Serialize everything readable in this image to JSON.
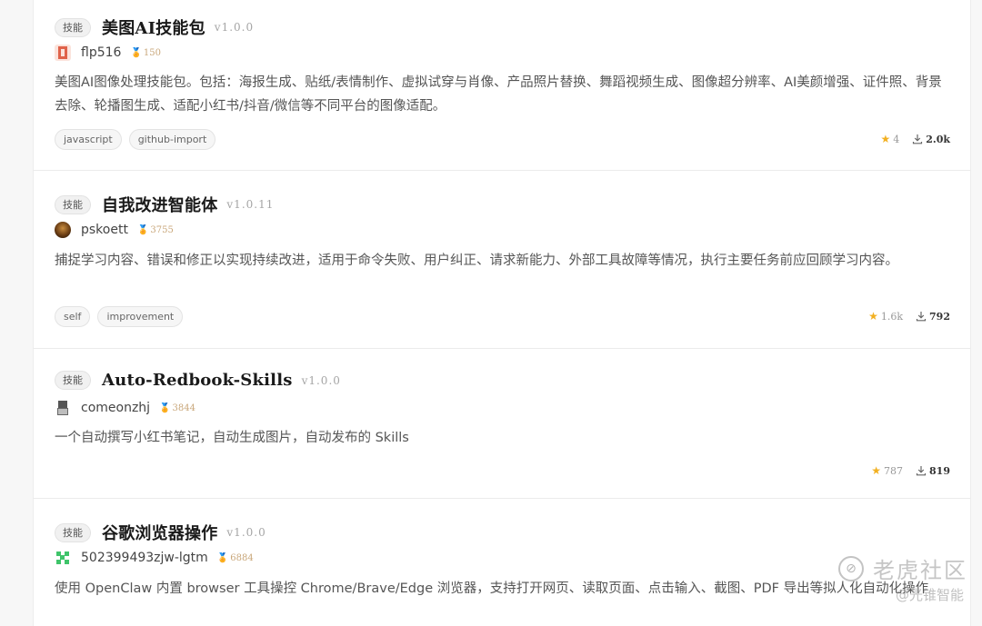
{
  "skills": [
    {
      "type": "技能",
      "name": "美图AI技能包",
      "version": "v1.0.0",
      "author": "flp516",
      "reputation": "150",
      "description": "美图AI图像处理技能包。包括：海报生成、贴纸/表情制作、虚拟试穿与肖像、产品照片替换、舞蹈视频生成、图像超分辨率、AI美颜增强、证件照、背景去除、轮播图生成、适配小红书/抖音/微信等不同平台的图像适配。",
      "tags": [
        "javascript",
        "github-import"
      ],
      "stars": "4",
      "downloads": "2.0k"
    },
    {
      "type": "技能",
      "name": "自我改进智能体",
      "version": "v1.0.11",
      "author": "pskoett",
      "reputation": "3755",
      "description": "捕捉学习内容、错误和修正以实现持续改进，适用于命令失败、用户纠正、请求新能力、外部工具故障等情况，执行主要任务前应回顾学习内容。",
      "tags": [
        "self",
        "improvement"
      ],
      "stars": "1.6k",
      "downloads": "792"
    },
    {
      "type": "技能",
      "name": "Auto-Redbook-Skills",
      "version": "v1.0.0",
      "author": "comeonzhj",
      "reputation": "3844",
      "description": "一个自动撰写小红书笔记，自动生成图片，自动发布的 Skills",
      "tags": [],
      "stars": "787",
      "downloads": "819"
    },
    {
      "type": "技能",
      "name": "谷歌浏览器操作",
      "version": "v1.0.0",
      "author": "502399493zjw-lgtm",
      "reputation": "6884",
      "description": "使用 OpenClaw 内置 browser 工具操控 Chrome/Brave/Edge 浏览器，支持打开网页、读取页面、点击输入、截图、PDF 导出等拟人化自动化操作"
    }
  ],
  "icons": {
    "type_badge": "tag-badge",
    "reputation": "medal-icon",
    "star": "star-icon",
    "download": "download-icon"
  },
  "colors": {
    "star": "#f2b021",
    "reputation": "#d9a441",
    "accent_text": "#1a1a1a"
  },
  "watermark": {
    "logo_glyph": "⊘",
    "main": "老虎社区",
    "sub": "@光锥智能"
  }
}
